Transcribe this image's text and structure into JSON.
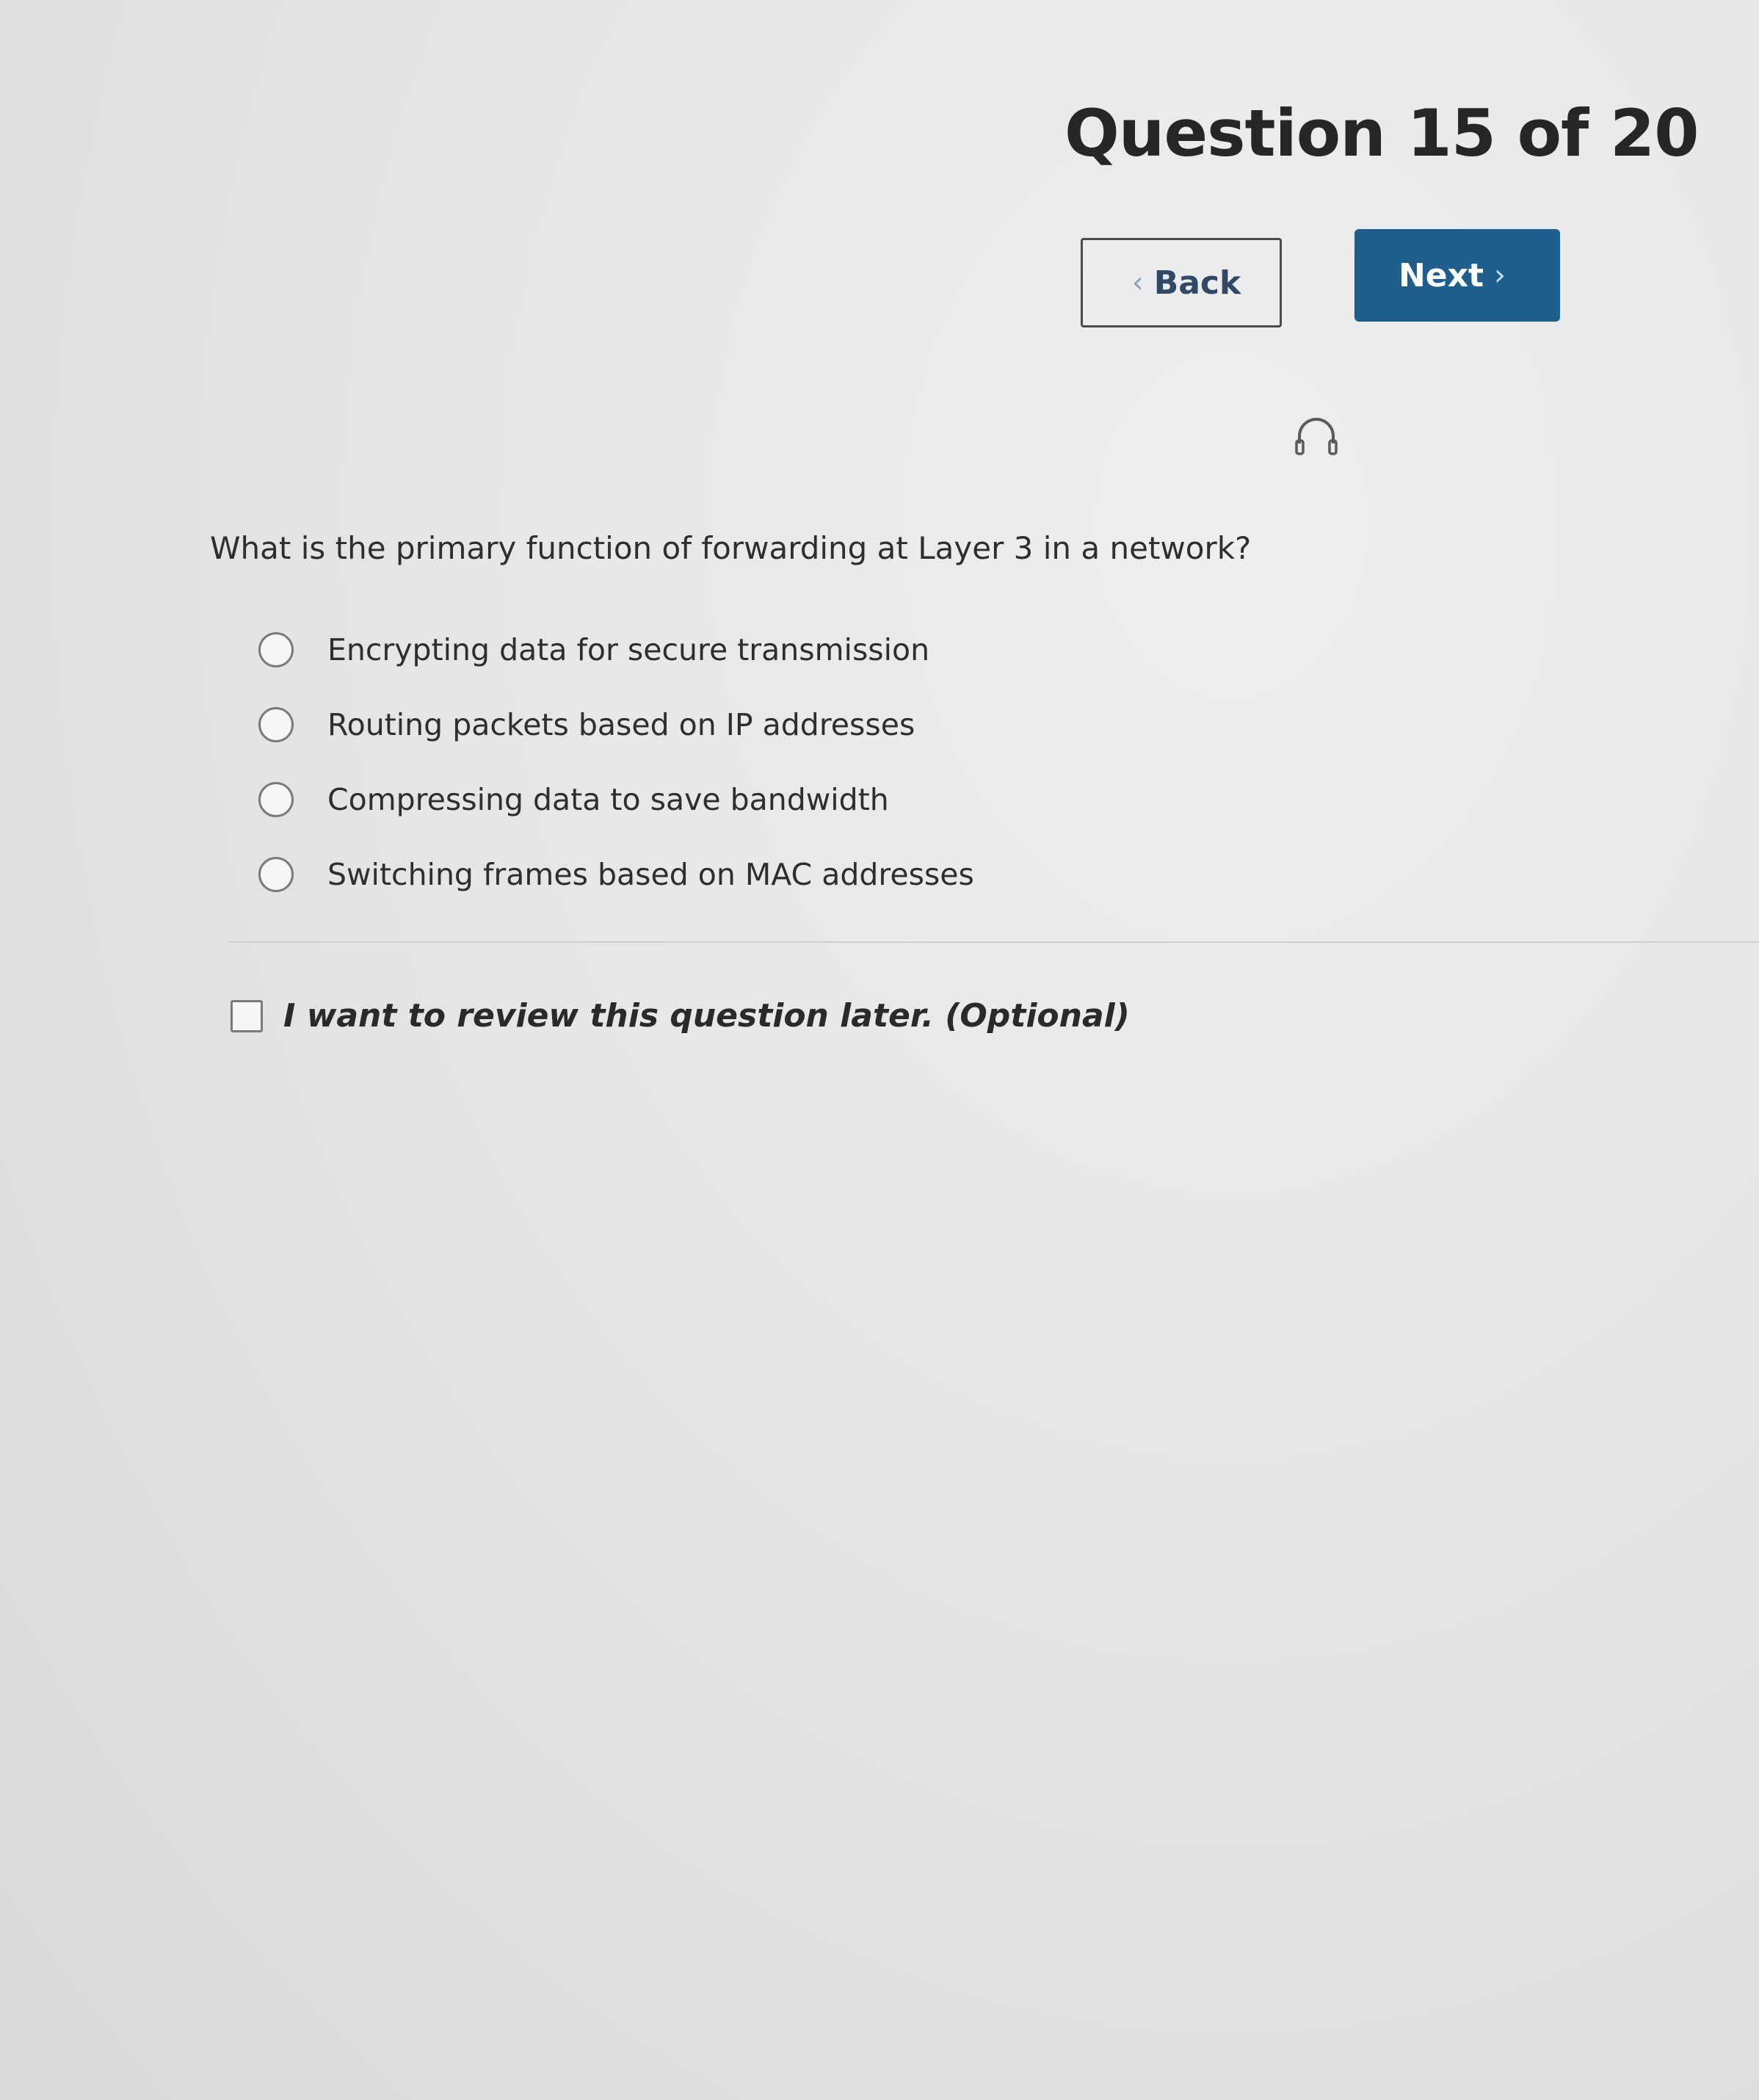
{
  "header": {
    "title": "Question 15 of 20"
  },
  "navigation": {
    "back_label": "Back",
    "next_label": "Next",
    "back_icon": "chevron-left-icon",
    "next_icon": "chevron-right-icon"
  },
  "toolbar": {
    "audio_icon": "headphones-icon"
  },
  "question": {
    "text": "What is the primary function of forwarding at Layer 3 in a network?",
    "options": [
      {
        "label": "Encrypting data for secure transmission",
        "selected": false
      },
      {
        "label": "Routing packets based on IP addresses",
        "selected": false
      },
      {
        "label": "Compressing data to save bandwidth",
        "selected": false
      },
      {
        "label": "Switching frames based on MAC addresses",
        "selected": false
      }
    ]
  },
  "review": {
    "label": "I want to review this question later. (Optional)",
    "checked": false
  },
  "colors": {
    "primary_button": "#1d5e8c",
    "back_text": "#2f4a66",
    "background": "#e6e6e6"
  }
}
